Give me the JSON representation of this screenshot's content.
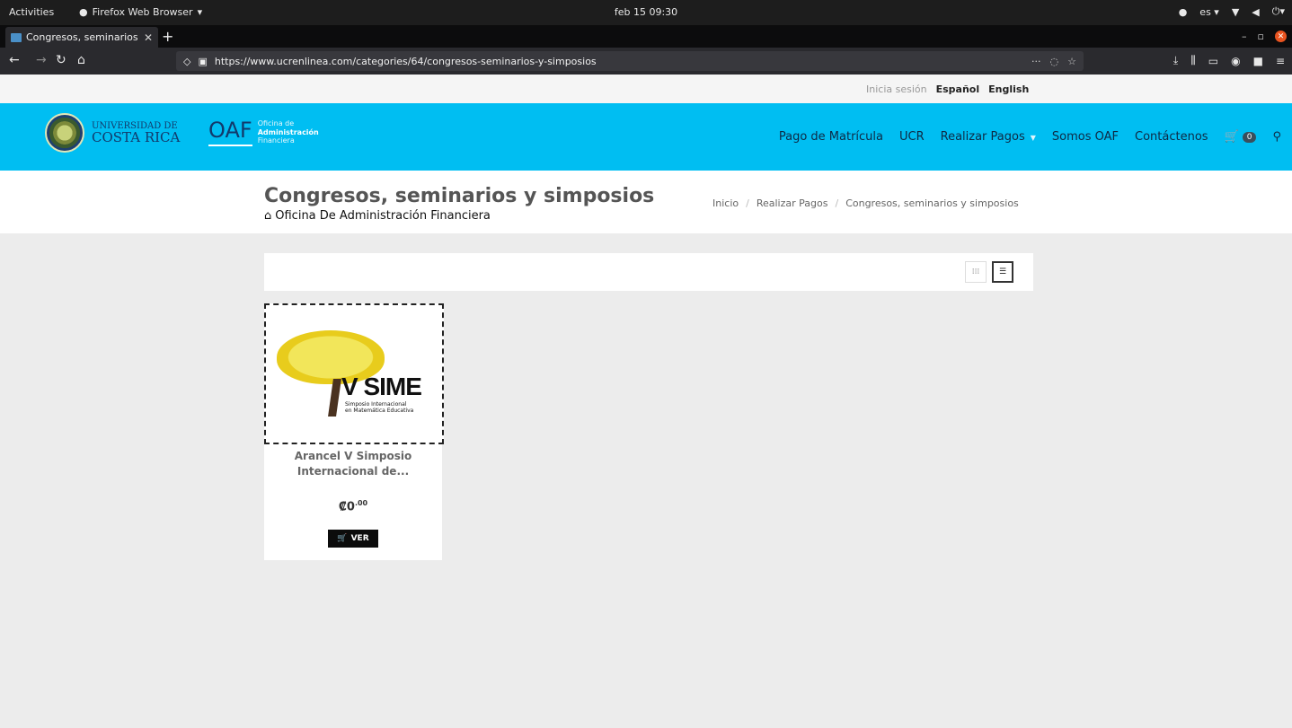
{
  "system_bar": {
    "activities": "Activities",
    "app_name": "Firefox Web Browser",
    "clock": "feb 15  09:30",
    "lang": "es"
  },
  "browser": {
    "tab_title": "Congresos, seminarios y",
    "url": "https://www.ucrenlinea.com/categories/64/congresos-seminarios-y-simposios"
  },
  "utility": {
    "login": "Inicia sesión",
    "lang_es": "Español",
    "lang_en": "English"
  },
  "header": {
    "ucr_line1": "UNIVERSIDAD DE",
    "ucr_line2": "COSTA RICA",
    "oaf_mark": "OAF",
    "oaf_sub1": "Oficina de",
    "oaf_sub2": "Administración",
    "oaf_sub3": "Financiera",
    "nav": {
      "pago": "Pago de Matrícula",
      "ucr": "UCR",
      "pagos": "Realizar Pagos",
      "somos": "Somos OAF",
      "contacto": "Contáctenos"
    },
    "cart_count": "0"
  },
  "page": {
    "title": "Congresos, seminarios y simposios",
    "subtitle": "Oficina De Administración Financiera",
    "breadcrumb": {
      "home": "Inicio",
      "parent": "Realizar Pagos",
      "current": "Congresos, seminarios y simposios"
    }
  },
  "product": {
    "image_title": "V SIME",
    "image_sub1": "Simposio Internacional",
    "image_sub2": "en Matemática Educativa",
    "name_line1": "Arancel V Simposio",
    "name_line2": "Internacional de...",
    "price_main": "₡0",
    "price_cents": ".00",
    "button": "VER"
  },
  "colors": {
    "header_bg": "#00bef2",
    "button_bg": "#0c0c0c"
  }
}
